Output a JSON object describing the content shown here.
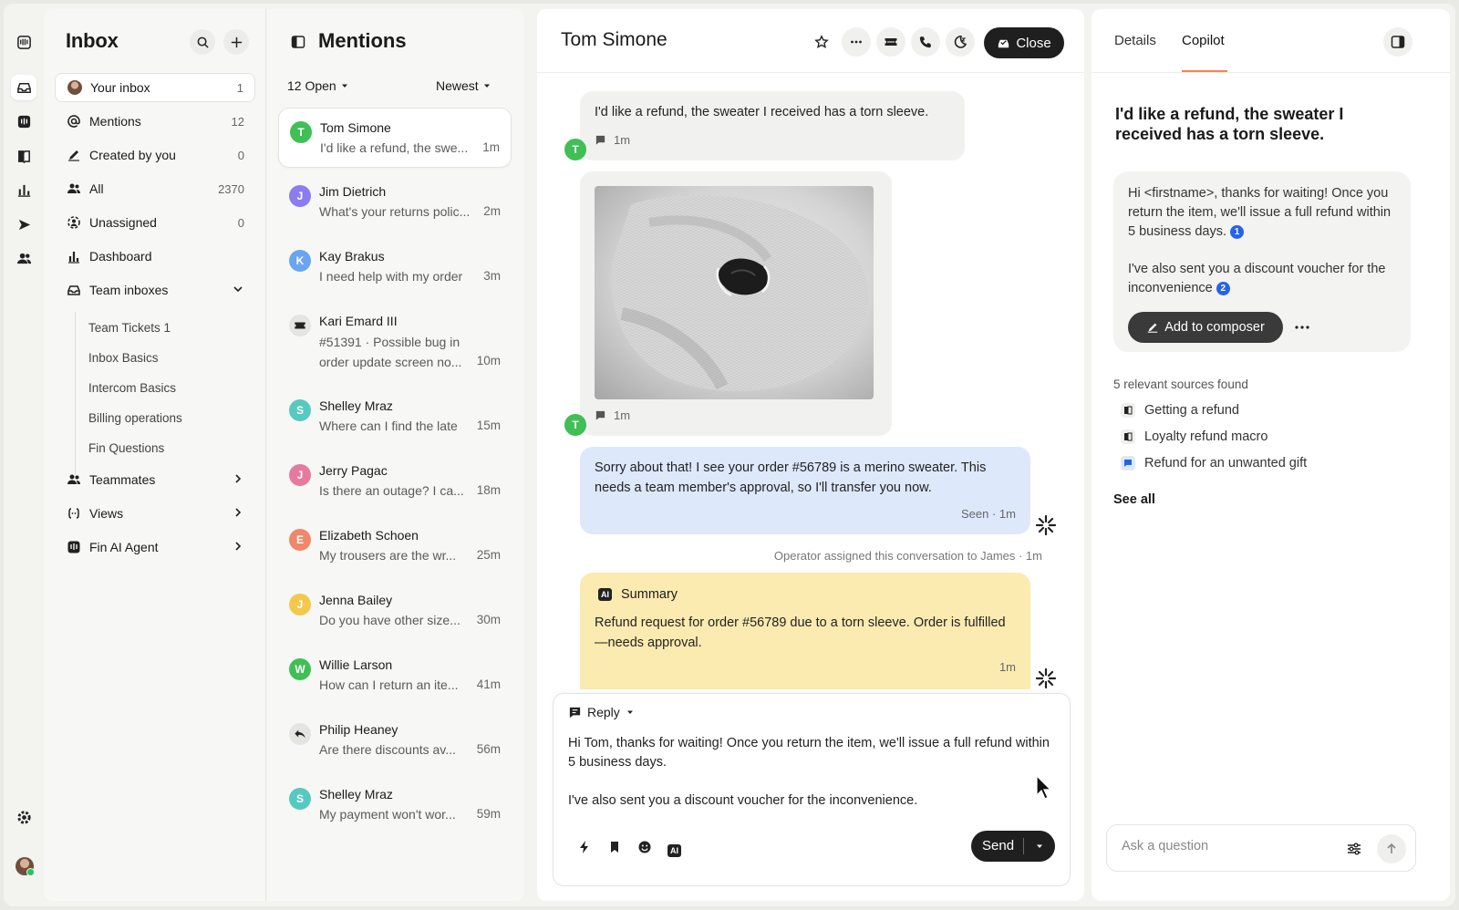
{
  "colors": {
    "accent": "#f0865a",
    "dark_button": "#1f1f1f",
    "agent_bubble": "#dde8fb",
    "summary_bubble": "#fcebb0",
    "citation": "#2563eb"
  },
  "rail": {
    "icons": [
      "fin-logo-icon",
      "inbox-icon",
      "fin-agent-icon",
      "knowledge-book-icon",
      "reports-chart-icon",
      "outbound-send-icon",
      "contacts-icon",
      "settings-gear-icon"
    ]
  },
  "nav": {
    "title": "Inbox",
    "items": [
      {
        "label": "Your inbox",
        "count": "1",
        "icon": "avatar"
      },
      {
        "label": "Mentions",
        "count": "12",
        "icon": "at-icon"
      },
      {
        "label": "Created by you",
        "count": "0",
        "icon": "pencil-icon"
      },
      {
        "label": "All",
        "count": "2370",
        "icon": "people-icon"
      },
      {
        "label": "Unassigned",
        "count": "0",
        "icon": "unassigned-icon"
      },
      {
        "label": "Dashboard",
        "count": "",
        "icon": "bar-chart-icon"
      },
      {
        "label": "Team inboxes",
        "count": "",
        "icon": "tray-icon"
      }
    ],
    "team_inboxes": [
      "Team Tickets 1",
      "Inbox Basics",
      "Intercom Basics",
      "Billing operations",
      "Fin Questions"
    ],
    "groups": [
      {
        "label": "Teammates",
        "icon": "people-icon"
      },
      {
        "label": "Views",
        "icon": "views-icon"
      },
      {
        "label": "Fin AI Agent",
        "icon": "fin-icon"
      }
    ]
  },
  "list": {
    "title": "Mentions",
    "filter_status": "12 Open",
    "filter_sort": "Newest",
    "conversations": [
      {
        "initial": "T",
        "color": "#3fbf55",
        "name": "Tom Simone",
        "preview": "I'd like a refund, the swe...",
        "time": "1m"
      },
      {
        "initial": "J",
        "color": "#8b7cf0",
        "name": "Jim Dietrich",
        "preview": "What's your returns polic...",
        "time": "2m"
      },
      {
        "initial": "K",
        "color": "#6aa5f0",
        "name": "Kay Brakus",
        "preview": "I need help with my order",
        "time": "3m"
      },
      {
        "initial": "",
        "color": "#e4e4e0",
        "name": "Kari Emard III",
        "preview": "#51391 · Possible bug in order update screen no...",
        "time": "10m"
      },
      {
        "initial": "S",
        "color": "#56c9c0",
        "name": "Shelley Mraz",
        "preview": "Where can I find the late",
        "time": "15m"
      },
      {
        "initial": "J",
        "color": "#e57aa1",
        "name": "Jerry Pagac",
        "preview": "Is there an outage? I ca...",
        "time": "18m"
      },
      {
        "initial": "E",
        "color": "#f0866a",
        "name": "Elizabeth Schoen",
        "preview": "My trousers are the wr...",
        "time": "25m"
      },
      {
        "initial": "J",
        "color": "#f2c94c",
        "name": "Jenna Bailey",
        "preview": "Do you have other size...",
        "time": "30m"
      },
      {
        "initial": "W",
        "color": "#3fbf55",
        "name": "Willie Larson",
        "preview": "How can I return an ite...",
        "time": "41m"
      },
      {
        "initial": "",
        "color": "#e4e4e0",
        "name": "Philip Heaney",
        "preview": "Are there discounts av...",
        "time": "56m"
      },
      {
        "initial": "S",
        "color": "#56c9c0",
        "name": "Shelley Mraz",
        "preview": "My payment won't wor...",
        "time": "59m"
      }
    ]
  },
  "conversation": {
    "title": "Tom Simone",
    "close_label": "Close",
    "messages": {
      "customer_text": "I'd like a refund, the sweater I received has a torn sleeve.",
      "customer_time": "1m",
      "customer_initial": "T",
      "image_time": "1m",
      "agent_text": "Sorry about that! I see your order #56789 is a merino sweater. This needs a team member's approval, so I'll transfer you now.",
      "agent_meta": "Seen · 1m",
      "system_note": "Operator assigned this conversation to James · 1m",
      "summary_badge": "AI",
      "summary_title": "Summary",
      "summary_text": "Refund request for order #56789 due to a torn sleeve. Order is fulfilled—needs approval.",
      "summary_time": "1m"
    },
    "composer": {
      "mode": "Reply",
      "text_line1": "Hi Tom, thanks for waiting! Once you return the item, we'll issue a full refund within 5 business days.",
      "text_line2": "I've also sent you a discount voucher for the inconvenience.",
      "send_label": "Send",
      "ai_badge": "AI"
    }
  },
  "copilot": {
    "tabs": [
      "Details",
      "Copilot"
    ],
    "question": "I'd like a refund, the sweater I received has a torn sleeve.",
    "answer_p1": "Hi <firstname>, thanks for waiting! Once you return the item, we'll issue a full refund within 5 business days.",
    "answer_p2": "I've also sent you a discount voucher for the inconvenience",
    "cite1": "1",
    "cite2": "2",
    "add_label": "Add to composer",
    "sources_heading": "5 relevant sources found",
    "sources": [
      "Getting a refund",
      "Loyalty refund macro",
      "Refund for an unwanted gift"
    ],
    "see_all": "See all",
    "ask_placeholder": "Ask a question"
  }
}
